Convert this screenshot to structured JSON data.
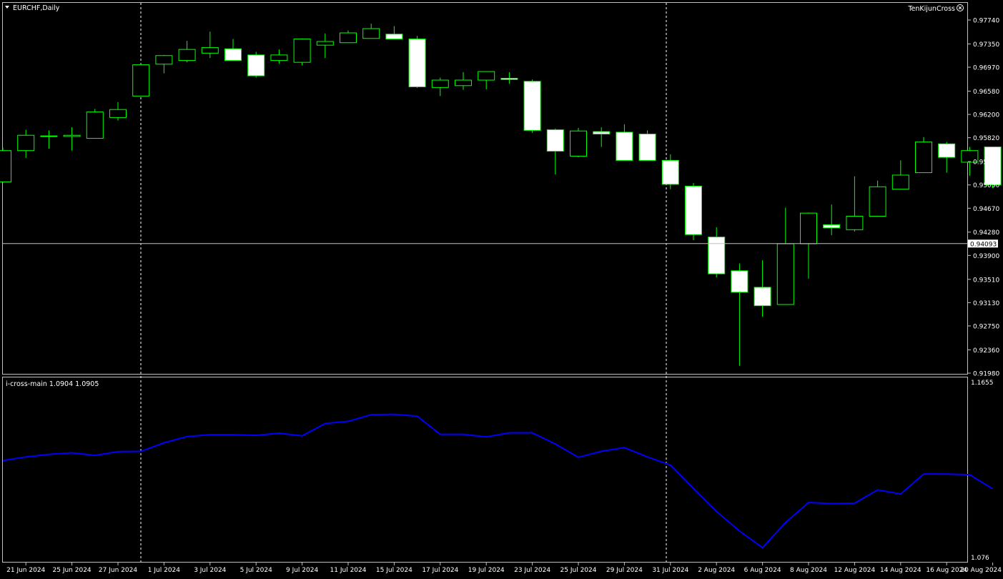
{
  "main_panel": {
    "symbol_label": "EURCHF,Daily",
    "indicator_name": "TenKijunCross",
    "current_price": "0.94093",
    "price_ticks": [
      "0.97740",
      "0.97350",
      "0.96970",
      "0.96580",
      "0.96200",
      "0.95820",
      "0.95430",
      "0.95050",
      "0.94670",
      "0.94280",
      "0.93900",
      "0.93510",
      "0.93130",
      "0.92750",
      "0.92360",
      "0.91980"
    ]
  },
  "sub_panel": {
    "label": "i-cross-main 1.0904 1.0905",
    "max_label": "1.1655",
    "min_label": "1.076"
  },
  "time_labels": [
    "21 Jun 2024",
    "25 Jun 2024",
    "27 Jun 2024",
    "1 Jul 2024",
    "3 Jul 2024",
    "5 Jul 2024",
    "9 Jul 2024",
    "11 Jul 2024",
    "15 Jul 2024",
    "17 Jul 2024",
    "19 Jul 2024",
    "23 Jul 2024",
    "25 Jul 2024",
    "29 Jul 2024",
    "31 Jul 2024",
    "2 Aug 2024",
    "6 Aug 2024",
    "8 Aug 2024",
    "12 Aug 2024",
    "14 Aug 2024",
    "16 Aug 2024",
    "20 Aug 2024"
  ],
  "colors": {
    "background": "#000000",
    "bull_outline": "#00ff00",
    "bear_fill": "#ffffff",
    "indicator_line": "#0000ff",
    "grid_line": "#c0c0c0"
  },
  "chart_data": [
    {
      "type": "candlestick",
      "title": "EURCHF,Daily",
      "ylim": [
        0.9198,
        0.9774
      ],
      "current_price": 0.94093,
      "dates": [
        "20 Jun 2024",
        "21 Jun 2024",
        "24 Jun 2024",
        "25 Jun 2024",
        "26 Jun 2024",
        "27 Jun 2024",
        "28 Jun 2024",
        "1 Jul 2024",
        "2 Jul 2024",
        "3 Jul 2024",
        "4 Jul 2024",
        "5 Jul 2024",
        "8 Jul 2024",
        "9 Jul 2024",
        "10 Jul 2024",
        "11 Jul 2024",
        "12 Jul 2024",
        "15 Jul 2024",
        "16 Jul 2024",
        "17 Jul 2024",
        "18 Jul 2024",
        "19 Jul 2024",
        "22 Jul 2024",
        "23 Jul 2024",
        "24 Jul 2024",
        "25 Jul 2024",
        "26 Jul 2024",
        "29 Jul 2024",
        "30 Jul 2024",
        "31 Jul 2024",
        "1 Aug 2024",
        "2 Aug 2024",
        "5 Aug 2024",
        "6 Aug 2024",
        "7 Aug 2024",
        "8 Aug 2024",
        "9 Aug 2024",
        "12 Aug 2024",
        "13 Aug 2024",
        "14 Aug 2024",
        "15 Aug 2024",
        "16 Aug 2024",
        "19 Aug 2024",
        "20 Aug 2024"
      ],
      "ohlc": [
        [
          0.951,
          0.9566,
          0.9508,
          0.9561
        ],
        [
          0.9561,
          0.9595,
          0.9549,
          0.9586
        ],
        [
          0.9584,
          0.9594,
          0.9564,
          0.9585
        ],
        [
          0.9584,
          0.9599,
          0.9561,
          0.9586
        ],
        [
          0.9581,
          0.9629,
          0.9581,
          0.9624
        ],
        [
          0.9615,
          0.964,
          0.961,
          0.9628
        ],
        [
          0.965,
          0.9703,
          0.965,
          0.9701
        ],
        [
          0.9702,
          0.9717,
          0.9687,
          0.9716
        ],
        [
          0.9708,
          0.974,
          0.9705,
          0.9726
        ],
        [
          0.972,
          0.9755,
          0.9712,
          0.9729
        ],
        [
          0.9727,
          0.9743,
          0.9708,
          0.9708
        ],
        [
          0.9717,
          0.9722,
          0.968,
          0.9683
        ],
        [
          0.9708,
          0.9726,
          0.9703,
          0.9717
        ],
        [
          0.9705,
          0.9744,
          0.97,
          0.9743
        ],
        [
          0.9733,
          0.9752,
          0.9712,
          0.9739
        ],
        [
          0.9737,
          0.9757,
          0.9737,
          0.9753
        ],
        [
          0.9744,
          0.9768,
          0.9744,
          0.976
        ],
        [
          0.9751,
          0.9764,
          0.9745,
          0.9743
        ],
        [
          0.9743,
          0.9748,
          0.9663,
          0.9665
        ],
        [
          0.9664,
          0.968,
          0.965,
          0.9676
        ],
        [
          0.9667,
          0.9689,
          0.966,
          0.9676
        ],
        [
          0.9676,
          0.969,
          0.9661,
          0.969
        ],
        [
          0.9679,
          0.9689,
          0.967,
          0.9677
        ],
        [
          0.9674,
          0.9677,
          0.959,
          0.9594
        ],
        [
          0.9595,
          0.9597,
          0.9522,
          0.956
        ],
        [
          0.9552,
          0.9598,
          0.955,
          0.9593
        ],
        [
          0.9592,
          0.9599,
          0.9567,
          0.9588
        ],
        [
          0.9591,
          0.9604,
          0.957,
          0.9545
        ],
        [
          0.9588,
          0.9594,
          0.9545,
          0.9545
        ],
        [
          0.9545,
          0.9555,
          0.9498,
          0.9506
        ],
        [
          0.9503,
          0.9508,
          0.9415,
          0.9424
        ],
        [
          0.942,
          0.9436,
          0.9354,
          0.936
        ],
        [
          0.9365,
          0.9377,
          0.921,
          0.933
        ],
        [
          0.9338,
          0.9382,
          0.929,
          0.9308
        ],
        [
          0.931,
          0.9468,
          0.931,
          0.9409
        ],
        [
          0.9409,
          0.946,
          0.9352,
          0.9459
        ],
        [
          0.944,
          0.9473,
          0.9423,
          0.9435
        ],
        [
          0.9432,
          0.9519,
          0.9429,
          0.9454
        ],
        [
          0.9454,
          0.9512,
          0.9454,
          0.9502
        ],
        [
          0.9498,
          0.9545,
          0.9498,
          0.9521
        ],
        [
          0.9525,
          0.9583,
          0.9525,
          0.9575
        ],
        [
          0.9572,
          0.9575,
          0.9525,
          0.955
        ],
        [
          0.9542,
          0.9567,
          0.952,
          0.9561
        ],
        [
          0.9567,
          0.9567,
          0.95,
          0.9505
        ]
      ]
    },
    {
      "type": "line",
      "title": "i-cross-main 1.0904 1.0905",
      "ylim": [
        1.076,
        1.1655
      ],
      "series": [
        {
          "values": [
            1.126,
            1.128,
            1.1294,
            1.1302,
            1.1288,
            1.1308,
            1.131,
            1.1356,
            1.139,
            1.14,
            1.14,
            1.1396,
            1.1408,
            1.1394,
            1.146,
            1.1472,
            1.1508,
            1.151,
            1.15,
            1.1402,
            1.1402,
            1.1388,
            1.141,
            1.141,
            1.135,
            1.1278,
            1.131,
            1.133,
            1.128,
            1.1236,
            1.111,
            1.0986,
            1.088,
            1.079,
            1.0926,
            1.1034,
            1.1028,
            1.103,
            1.1102,
            1.108,
            1.1188,
            1.1188,
            1.1184,
            1.1108
          ]
        }
      ]
    }
  ]
}
